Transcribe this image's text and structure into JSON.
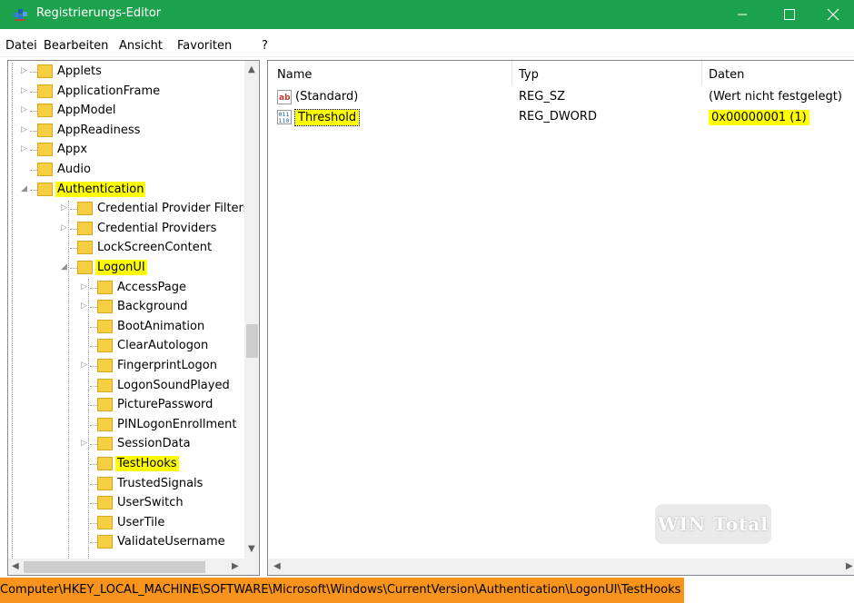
{
  "window": {
    "title": "Registrierungs-Editor",
    "minimize_glyph": "—",
    "close_glyph": "✕"
  },
  "menu": [
    "Datei",
    "Bearbeiten",
    "Ansicht",
    "Favoriten",
    "?"
  ],
  "tree": {
    "items": [
      {
        "label": "Applets",
        "expander": "▷",
        "highlighted": false
      },
      {
        "label": "ApplicationFrame",
        "expander": "▷",
        "highlighted": false
      },
      {
        "label": "AppModel",
        "expander": "▷",
        "highlighted": false
      },
      {
        "label": "AppReadiness",
        "expander": "▷",
        "highlighted": false
      },
      {
        "label": "Appx",
        "expander": "▷",
        "highlighted": false
      },
      {
        "label": "Audio",
        "expander": "",
        "highlighted": false
      },
      {
        "label": "Authentication",
        "expander": "◢",
        "highlighted": true
      },
      {
        "label": "Credential Provider Filters",
        "expander": "▷",
        "highlighted": false
      },
      {
        "label": "Credential Providers",
        "expander": "▷",
        "highlighted": false
      },
      {
        "label": "LockScreenContent",
        "expander": "",
        "highlighted": false
      },
      {
        "label": "LogonUI",
        "expander": "◢",
        "highlighted": true
      },
      {
        "label": "AccessPage",
        "expander": "▷",
        "highlighted": false
      },
      {
        "label": "Background",
        "expander": "▷",
        "highlighted": false
      },
      {
        "label": "BootAnimation",
        "expander": "",
        "highlighted": false
      },
      {
        "label": "ClearAutologon",
        "expander": "",
        "highlighted": false
      },
      {
        "label": "FingerprintLogon",
        "expander": "▷",
        "highlighted": false
      },
      {
        "label": "LogonSoundPlayed",
        "expander": "",
        "highlighted": false
      },
      {
        "label": "PicturePassword",
        "expander": "",
        "highlighted": false
      },
      {
        "label": "PINLogonEnrollment",
        "expander": "",
        "highlighted": false
      },
      {
        "label": "SessionData",
        "expander": "▷",
        "highlighted": false
      },
      {
        "label": "TestHooks",
        "expander": "",
        "highlighted": true
      },
      {
        "label": "TrustedSignals",
        "expander": "",
        "highlighted": false
      },
      {
        "label": "UserSwitch",
        "expander": "",
        "highlighted": false
      },
      {
        "label": "UserTile",
        "expander": "",
        "highlighted": false
      },
      {
        "label": "ValidateUsername",
        "expander": "",
        "highlighted": false
      }
    ]
  },
  "list": {
    "columns": [
      "Name",
      "Typ",
      "Daten"
    ],
    "rows": [
      {
        "name": "(Standard)",
        "type": "REG_SZ",
        "data": "(Wert nicht festgelegt)",
        "icon": "string-value-icon",
        "icon_text": "ab",
        "highlighted": false
      },
      {
        "name": "Threshold",
        "type": "REG_DWORD",
        "data": "0x00000001 (1)",
        "icon": "binary-value-icon",
        "icon_text": "011 110",
        "highlighted": true
      }
    ]
  },
  "watermark": "WIN Total",
  "status": {
    "path": "Computer\\HKEY_LOCAL_MACHINE\\SOFTWARE\\Microsoft\\Windows\\CurrentVersion\\Authentication\\LogonUI\\TestHooks"
  },
  "colors": {
    "titlebar": "#1ca24d",
    "highlight": "#ffff00",
    "statusbar_highlight": "#f7941d",
    "folder": "#f5ce42"
  }
}
